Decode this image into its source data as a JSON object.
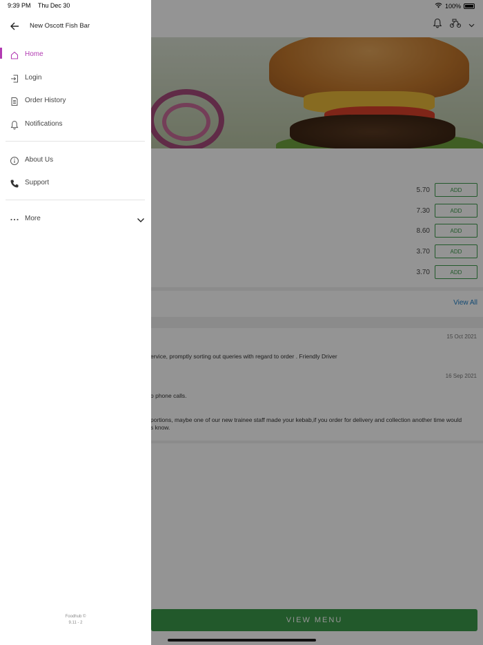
{
  "status_bar": {
    "time": "9:39 PM",
    "date": "Thu Dec 30",
    "battery": "100%"
  },
  "drawer": {
    "title": "New Oscott Fish Bar",
    "nav": [
      {
        "label": "Home",
        "icon": "home-icon",
        "active": true
      },
      {
        "label": "Login",
        "icon": "login-icon",
        "active": false
      },
      {
        "label": "Order History",
        "icon": "order-history-icon",
        "active": false
      },
      {
        "label": "Notifications",
        "icon": "bell-icon",
        "active": false
      }
    ],
    "nav2": [
      {
        "label": "About Us",
        "icon": "info-icon"
      },
      {
        "label": "Support",
        "icon": "phone-icon"
      }
    ],
    "more_label": "More",
    "footer_brand": "Foodhub ©",
    "footer_version": "9.11 - 2"
  },
  "menu": {
    "items": [
      {
        "price": "5.70",
        "add_label": "ADD"
      },
      {
        "price": "7.30",
        "add_label": "ADD"
      },
      {
        "price": "8.60",
        "add_label": "ADD"
      },
      {
        "price": "3.70",
        "add_label": "ADD"
      },
      {
        "price": "3.70",
        "add_label": "ADD"
      }
    ]
  },
  "reviews": {
    "view_all": "View All",
    "items": [
      {
        "date": "15 Oct 2021",
        "text": "ervice, promptly sorting out queries with regard to order . Friendly Driver"
      },
      {
        "date": "16 Sep 2021",
        "text": "o phone calls."
      }
    ],
    "reply_text_1": "portions, maybe one of our new trainee staff made your kebab,if you order for delivery and collection another time would",
    "reply_text_2": "s know."
  },
  "view_menu_label": "VIEW MENU",
  "colors": {
    "accent": "#b23bb2",
    "green": "#3c9a4a",
    "link": "#1f7fc6"
  }
}
